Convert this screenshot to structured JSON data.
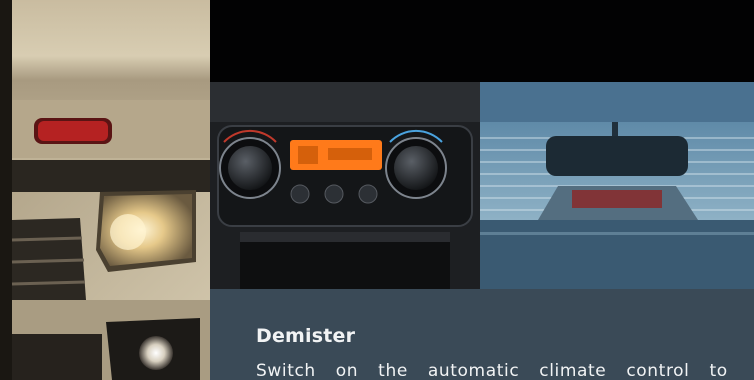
{
  "feature": {
    "title": "Demister",
    "description": "Switch on the automatic climate control to"
  },
  "photos": {
    "car": "car-front-headlamp",
    "dashboard": "climate-control-panel",
    "mirror": "rear-window-demister-view"
  },
  "colors": {
    "text_panel": "#3a4a57",
    "display_orange": "#ff7a1a",
    "background": "#000000"
  }
}
